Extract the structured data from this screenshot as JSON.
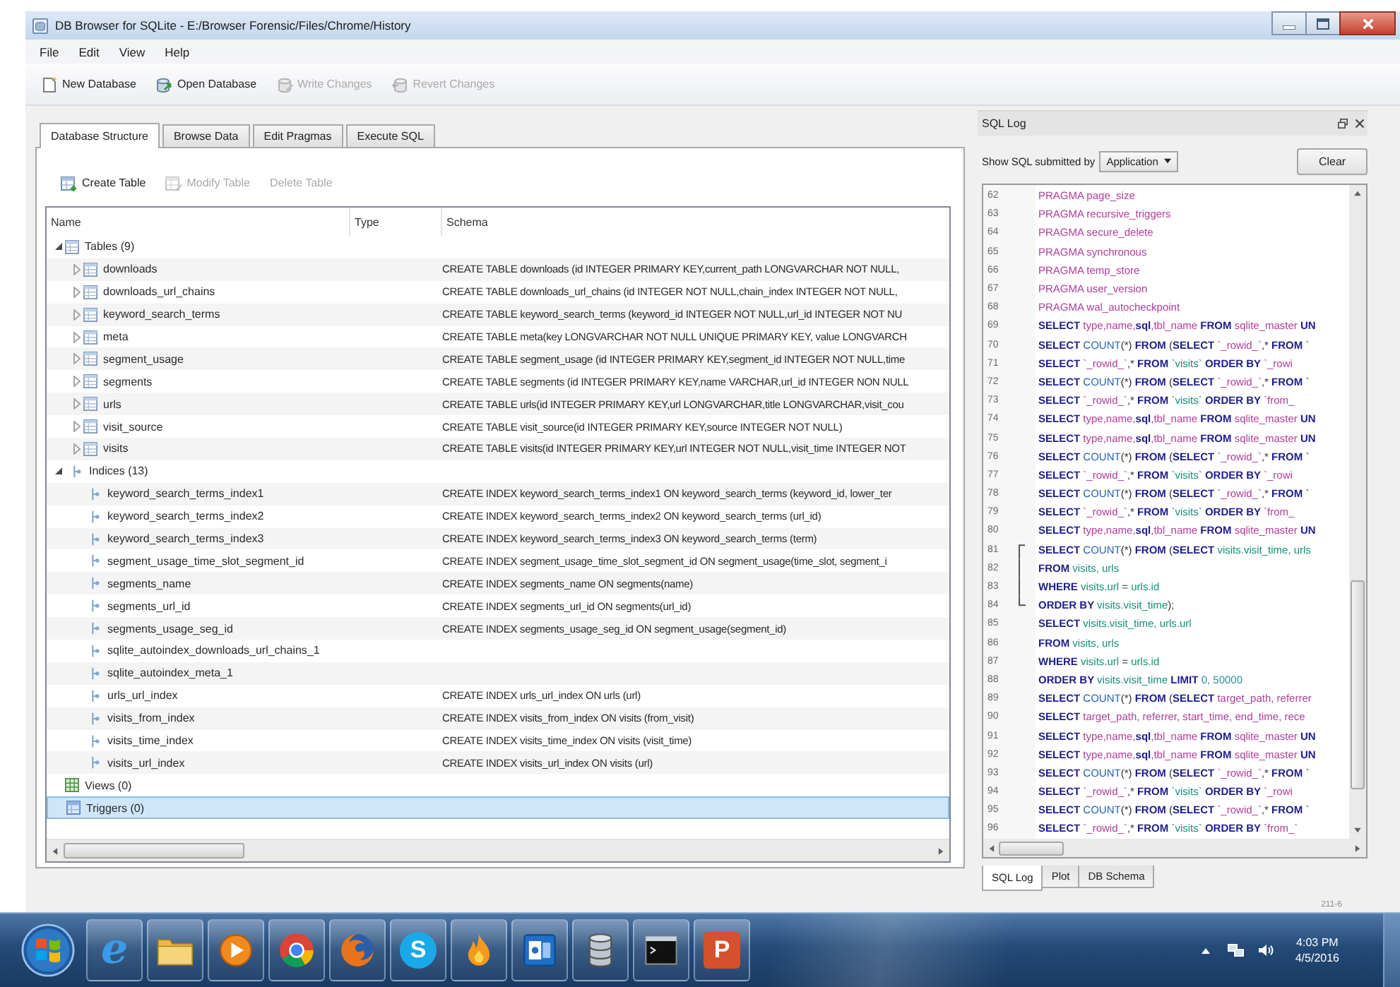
{
  "window": {
    "title": "DB Browser for SQLite - E:/Browser Forensic/Files/Chrome/History"
  },
  "menu": [
    "File",
    "Edit",
    "View",
    "Help"
  ],
  "toolbar": [
    {
      "label": "New Database",
      "kind": "new",
      "disabled": false
    },
    {
      "label": "Open Database",
      "kind": "open",
      "disabled": false
    },
    {
      "label": "Write Changes",
      "kind": "write",
      "disabled": true
    },
    {
      "label": "Revert Changes",
      "kind": "revert",
      "disabled": true
    }
  ],
  "tabs": [
    {
      "label": "Database Structure",
      "selected": true
    },
    {
      "label": "Browse Data",
      "selected": false
    },
    {
      "label": "Edit Pragmas",
      "selected": false
    },
    {
      "label": "Execute SQL",
      "selected": false
    }
  ],
  "actions": [
    {
      "label": "Create Table",
      "kind": "create",
      "disabled": false
    },
    {
      "label": "Modify Table",
      "kind": "modify",
      "disabled": true
    },
    {
      "label": "Delete Table",
      "kind": "delete",
      "disabled": true
    }
  ],
  "tree": {
    "columns": [
      "Name",
      "Type",
      "Schema"
    ],
    "items": [
      {
        "name": "Tables (9)",
        "kind": "table",
        "expanded": true,
        "selected": false,
        "children": [
          {
            "name": "downloads",
            "kind": "table",
            "expanded": false,
            "selected": false,
            "schema": "CREATE TABLE downloads (id INTEGER PRIMARY KEY,current_path LONGVARCHAR NOT NULL,"
          },
          {
            "name": "downloads_url_chains",
            "kind": "table",
            "expanded": false,
            "selected": false,
            "schema": "CREATE TABLE downloads_url_chains (id INTEGER NOT NULL,chain_index INTEGER NOT NULL,"
          },
          {
            "name": "keyword_search_terms",
            "kind": "table",
            "expanded": false,
            "selected": false,
            "schema": "CREATE TABLE keyword_search_terms (keyword_id INTEGER NOT NULL,url_id INTEGER NOT NU"
          },
          {
            "name": "meta",
            "kind": "table",
            "expanded": false,
            "selected": false,
            "schema": "CREATE TABLE meta(key LONGVARCHAR NOT NULL UNIQUE PRIMARY KEY, value LONGVARCH"
          },
          {
            "name": "segment_usage",
            "kind": "table",
            "expanded": false,
            "selected": false,
            "schema": "CREATE TABLE segment_usage (id INTEGER PRIMARY KEY,segment_id INTEGER NOT NULL,time"
          },
          {
            "name": "segments",
            "kind": "table",
            "expanded": false,
            "selected": false,
            "schema": "CREATE TABLE segments (id INTEGER PRIMARY KEY,name VARCHAR,url_id INTEGER NON NULL"
          },
          {
            "name": "urls",
            "kind": "table",
            "expanded": false,
            "selected": false,
            "schema": "CREATE TABLE urls(id INTEGER PRIMARY KEY,url LONGVARCHAR,title LONGVARCHAR,visit_cou"
          },
          {
            "name": "visit_source",
            "kind": "table",
            "expanded": false,
            "selected": false,
            "schema": "CREATE TABLE visit_source(id INTEGER PRIMARY KEY,source INTEGER NOT NULL)"
          },
          {
            "name": "visits",
            "kind": "table",
            "expanded": false,
            "selected": false,
            "schema": "CREATE TABLE visits(id INTEGER PRIMARY KEY,url INTEGER NOT NULL,visit_time INTEGER NOT"
          }
        ]
      },
      {
        "name": "Indices (13)",
        "kind": "index",
        "expanded": true,
        "selected": false,
        "children": [
          {
            "name": "keyword_search_terms_index1",
            "kind": "index",
            "selected": false,
            "schema": "CREATE INDEX keyword_search_terms_index1 ON keyword_search_terms (keyword_id, lower_ter"
          },
          {
            "name": "keyword_search_terms_index2",
            "kind": "index",
            "selected": false,
            "schema": "CREATE INDEX keyword_search_terms_index2 ON keyword_search_terms (url_id)"
          },
          {
            "name": "keyword_search_terms_index3",
            "kind": "index",
            "selected": false,
            "schema": "CREATE INDEX keyword_search_terms_index3 ON keyword_search_terms (term)"
          },
          {
            "name": "segment_usage_time_slot_segment_id",
            "kind": "index",
            "selected": false,
            "schema": "CREATE INDEX segment_usage_time_slot_segment_id ON segment_usage(time_slot, segment_i"
          },
          {
            "name": "segments_name",
            "kind": "index",
            "selected": false,
            "schema": "CREATE INDEX segments_name ON segments(name)"
          },
          {
            "name": "segments_url_id",
            "kind": "index",
            "selected": false,
            "schema": "CREATE INDEX segments_url_id ON segments(url_id)"
          },
          {
            "name": "segments_usage_seg_id",
            "kind": "index",
            "selected": false,
            "schema": "CREATE INDEX segments_usage_seg_id ON segment_usage(segment_id)"
          },
          {
            "name": "sqlite_autoindex_downloads_url_chains_1",
            "kind": "index",
            "selected": false
          },
          {
            "name": "sqlite_autoindex_meta_1",
            "kind": "index",
            "selected": false
          },
          {
            "name": "urls_url_index",
            "kind": "index",
            "selected": false,
            "schema": "CREATE INDEX urls_url_index ON urls (url)"
          },
          {
            "name": "visits_from_index",
            "kind": "index",
            "selected": false,
            "schema": "CREATE INDEX visits_from_index ON visits (from_visit)"
          },
          {
            "name": "visits_time_index",
            "kind": "index",
            "selected": false,
            "schema": "CREATE INDEX visits_time_index ON visits (visit_time)"
          },
          {
            "name": "visits_url_index",
            "kind": "index",
            "selected": false,
            "schema": "CREATE INDEX visits_url_index ON visits (url)"
          }
        ]
      },
      {
        "name": "Views (0)",
        "kind": "view",
        "selected": false
      },
      {
        "name": "Triggers (0)",
        "kind": "trigger",
        "selected": true
      }
    ]
  },
  "sql_log": {
    "title": "SQL Log",
    "filter_label": "Show SQL submitted by",
    "filter_value": "Application",
    "clear_label": "Clear",
    "lines": [
      {
        "number": "62",
        "tokens": [
          {
            "kind": "identifier",
            "text": "PRAGMA page_size"
          }
        ]
      },
      {
        "number": "63",
        "tokens": [
          {
            "kind": "identifier",
            "text": "PRAGMA recursive_triggers"
          }
        ]
      },
      {
        "number": "64",
        "tokens": [
          {
            "kind": "identifier",
            "text": "PRAGMA secure_delete"
          }
        ]
      },
      {
        "number": "65",
        "tokens": [
          {
            "kind": "identifier",
            "text": "PRAGMA synchronous"
          }
        ]
      },
      {
        "number": "66",
        "tokens": [
          {
            "kind": "identifier",
            "text": "PRAGMA temp_store"
          }
        ]
      },
      {
        "number": "67",
        "tokens": [
          {
            "kind": "identifier",
            "text": "PRAGMA user_version"
          }
        ]
      },
      {
        "number": "68",
        "tokens": [
          {
            "kind": "identifier",
            "text": "PRAGMA wal_autocheckpoint"
          }
        ]
      },
      {
        "number": "69",
        "tokens": [
          {
            "kind": "keyword",
            "text": "SELECT "
          },
          {
            "kind": "identifier",
            "text": "type,name,"
          },
          {
            "kind": "keyword",
            "text": "sql"
          },
          {
            "kind": "identifier",
            "text": ",tbl_name "
          },
          {
            "kind": "keyword",
            "text": "FROM "
          },
          {
            "kind": "identifier",
            "text": "sqlite_master "
          },
          {
            "kind": "keyword",
            "text": "UN"
          }
        ]
      },
      {
        "number": "70",
        "tokens": [
          {
            "kind": "keyword",
            "text": "SELECT "
          },
          {
            "kind": "function",
            "text": "COUNT"
          },
          {
            "kind": "punct",
            "text": "(*) "
          },
          {
            "kind": "keyword",
            "text": "FROM "
          },
          {
            "kind": "punct",
            "text": "("
          },
          {
            "kind": "keyword",
            "text": "SELECT "
          },
          {
            "kind": "identifier",
            "text": "`_rowid_`"
          },
          {
            "kind": "punct",
            "text": ",* "
          },
          {
            "kind": "keyword",
            "text": "FROM "
          },
          {
            "kind": "punct",
            "text": "`"
          }
        ]
      },
      {
        "number": "71",
        "tokens": [
          {
            "kind": "keyword",
            "text": "SELECT "
          },
          {
            "kind": "identifier",
            "text": "`_rowid_`"
          },
          {
            "kind": "punct",
            "text": ",* "
          },
          {
            "kind": "keyword",
            "text": "FROM "
          },
          {
            "kind": "object",
            "text": "`visits` "
          },
          {
            "kind": "keyword",
            "text": "ORDER BY "
          },
          {
            "kind": "identifier",
            "text": "`_rowi"
          }
        ]
      },
      {
        "number": "72",
        "tokens": [
          {
            "kind": "keyword",
            "text": "SELECT "
          },
          {
            "kind": "function",
            "text": "COUNT"
          },
          {
            "kind": "punct",
            "text": "(*) "
          },
          {
            "kind": "keyword",
            "text": "FROM "
          },
          {
            "kind": "punct",
            "text": "("
          },
          {
            "kind": "keyword",
            "text": "SELECT "
          },
          {
            "kind": "identifier",
            "text": "`_rowid_`"
          },
          {
            "kind": "punct",
            "text": ",* "
          },
          {
            "kind": "keyword",
            "text": "FROM "
          },
          {
            "kind": "punct",
            "text": "`"
          }
        ]
      },
      {
        "number": "73",
        "tokens": [
          {
            "kind": "keyword",
            "text": "SELECT "
          },
          {
            "kind": "identifier",
            "text": "`_rowid_`"
          },
          {
            "kind": "punct",
            "text": ",* "
          },
          {
            "kind": "keyword",
            "text": "FROM "
          },
          {
            "kind": "object",
            "text": "`visits` "
          },
          {
            "kind": "keyword",
            "text": "ORDER BY "
          },
          {
            "kind": "identifier",
            "text": "`from_"
          }
        ]
      },
      {
        "number": "74",
        "tokens": [
          {
            "kind": "keyword",
            "text": "SELECT "
          },
          {
            "kind": "identifier",
            "text": "type,name,"
          },
          {
            "kind": "keyword",
            "text": "sql"
          },
          {
            "kind": "identifier",
            "text": ",tbl_name "
          },
          {
            "kind": "keyword",
            "text": "FROM "
          },
          {
            "kind": "identifier",
            "text": "sqlite_master "
          },
          {
            "kind": "keyword",
            "text": "UN"
          }
        ]
      },
      {
        "number": "75",
        "tokens": [
          {
            "kind": "keyword",
            "text": "SELECT "
          },
          {
            "kind": "identifier",
            "text": "type,name,"
          },
          {
            "kind": "keyword",
            "text": "sql"
          },
          {
            "kind": "identifier",
            "text": ",tbl_name "
          },
          {
            "kind": "keyword",
            "text": "FROM "
          },
          {
            "kind": "identifier",
            "text": "sqlite_master "
          },
          {
            "kind": "keyword",
            "text": "UN"
          }
        ]
      },
      {
        "number": "76",
        "tokens": [
          {
            "kind": "keyword",
            "text": "SELECT "
          },
          {
            "kind": "function",
            "text": "COUNT"
          },
          {
            "kind": "punct",
            "text": "(*) "
          },
          {
            "kind": "keyword",
            "text": "FROM "
          },
          {
            "kind": "punct",
            "text": "("
          },
          {
            "kind": "keyword",
            "text": "SELECT "
          },
          {
            "kind": "identifier",
            "text": "`_rowid_`"
          },
          {
            "kind": "punct",
            "text": ",* "
          },
          {
            "kind": "keyword",
            "text": "FROM "
          },
          {
            "kind": "punct",
            "text": "`"
          }
        ]
      },
      {
        "number": "77",
        "tokens": [
          {
            "kind": "keyword",
            "text": "SELECT "
          },
          {
            "kind": "identifier",
            "text": "`_rowid_`"
          },
          {
            "kind": "punct",
            "text": ",* "
          },
          {
            "kind": "keyword",
            "text": "FROM "
          },
          {
            "kind": "object",
            "text": "`visits` "
          },
          {
            "kind": "keyword",
            "text": "ORDER BY "
          },
          {
            "kind": "identifier",
            "text": "`_rowi"
          }
        ]
      },
      {
        "number": "78",
        "tokens": [
          {
            "kind": "keyword",
            "text": "SELECT "
          },
          {
            "kind": "function",
            "text": "COUNT"
          },
          {
            "kind": "punct",
            "text": "(*) "
          },
          {
            "kind": "keyword",
            "text": "FROM "
          },
          {
            "kind": "punct",
            "text": "("
          },
          {
            "kind": "keyword",
            "text": "SELECT "
          },
          {
            "kind": "identifier",
            "text": "`_rowid_`"
          },
          {
            "kind": "punct",
            "text": ",* "
          },
          {
            "kind": "keyword",
            "text": "FROM "
          },
          {
            "kind": "punct",
            "text": "`"
          }
        ]
      },
      {
        "number": "79",
        "tokens": [
          {
            "kind": "keyword",
            "text": "SELECT "
          },
          {
            "kind": "identifier",
            "text": "`_rowid_`"
          },
          {
            "kind": "punct",
            "text": ",* "
          },
          {
            "kind": "keyword",
            "text": "FROM "
          },
          {
            "kind": "object",
            "text": "`visits` "
          },
          {
            "kind": "keyword",
            "text": "ORDER BY "
          },
          {
            "kind": "identifier",
            "text": "`from_"
          }
        ]
      },
      {
        "number": "80",
        "tokens": [
          {
            "kind": "keyword",
            "text": "SELECT "
          },
          {
            "kind": "identifier",
            "text": "type,name,"
          },
          {
            "kind": "keyword",
            "text": "sql"
          },
          {
            "kind": "identifier",
            "text": ",tbl_name "
          },
          {
            "kind": "keyword",
            "text": "FROM "
          },
          {
            "kind": "identifier",
            "text": "sqlite_master "
          },
          {
            "kind": "keyword",
            "text": "UN"
          }
        ]
      },
      {
        "number": "81",
        "kind": "fold_start",
        "tokens": [
          {
            "kind": "keyword",
            "text": "SELECT "
          },
          {
            "kind": "function",
            "text": "COUNT"
          },
          {
            "kind": "punct",
            "text": "(*) "
          },
          {
            "kind": "keyword",
            "text": "FROM "
          },
          {
            "kind": "punct",
            "text": "("
          },
          {
            "kind": "keyword",
            "text": "SELECT "
          },
          {
            "kind": "object",
            "text": "visits.visit_time, urls"
          }
        ]
      },
      {
        "number": "82",
        "kind": "fold_middle",
        "tokens": [
          {
            "kind": "keyword",
            "text": "FROM "
          },
          {
            "kind": "object",
            "text": "visits, urls"
          }
        ]
      },
      {
        "number": "83",
        "kind": "fold_middle",
        "tokens": [
          {
            "kind": "keyword",
            "text": "WHERE "
          },
          {
            "kind": "object",
            "text": "visits.url "
          },
          {
            "kind": "punct",
            "text": "= "
          },
          {
            "kind": "object",
            "text": "urls.id"
          }
        ]
      },
      {
        "number": "84",
        "kind": "fold_end",
        "tokens": [
          {
            "kind": "keyword",
            "text": "ORDER BY "
          },
          {
            "kind": "object",
            "text": "visits.visit_time"
          },
          {
            "kind": "punct",
            "text": ");"
          }
        ]
      },
      {
        "number": "85",
        "tokens": [
          {
            "kind": "keyword",
            "text": "SELECT "
          },
          {
            "kind": "object",
            "text": "visits.visit_time, urls.url"
          }
        ]
      },
      {
        "number": "86",
        "tokens": [
          {
            "kind": "keyword",
            "text": "FROM "
          },
          {
            "kind": "object",
            "text": "visits, urls"
          }
        ]
      },
      {
        "number": "87",
        "tokens": [
          {
            "kind": "keyword",
            "text": "WHERE "
          },
          {
            "kind": "object",
            "text": "visits.url "
          },
          {
            "kind": "punct",
            "text": "= "
          },
          {
            "kind": "object",
            "text": "urls.id"
          }
        ]
      },
      {
        "number": "88",
        "tokens": [
          {
            "kind": "keyword",
            "text": "ORDER BY "
          },
          {
            "kind": "object",
            "text": "visits.visit_time "
          },
          {
            "kind": "keyword",
            "text": "LIMIT "
          },
          {
            "kind": "number",
            "text": "0, 50000"
          }
        ]
      },
      {
        "number": "89",
        "tokens": [
          {
            "kind": "keyword",
            "text": "SELECT "
          },
          {
            "kind": "function",
            "text": "COUNT"
          },
          {
            "kind": "punct",
            "text": "(*) "
          },
          {
            "kind": "keyword",
            "text": "FROM "
          },
          {
            "kind": "punct",
            "text": "("
          },
          {
            "kind": "keyword",
            "text": "SELECT "
          },
          {
            "kind": "identifier",
            "text": "target_path, referrer"
          }
        ]
      },
      {
        "number": "90",
        "tokens": [
          {
            "kind": "keyword",
            "text": "SELECT "
          },
          {
            "kind": "identifier",
            "text": "target_path, referrer, start_time, end_time, rece"
          }
        ]
      },
      {
        "number": "91",
        "tokens": [
          {
            "kind": "keyword",
            "text": "SELECT "
          },
          {
            "kind": "identifier",
            "text": "type,name,"
          },
          {
            "kind": "keyword",
            "text": "sql"
          },
          {
            "kind": "identifier",
            "text": ",tbl_name "
          },
          {
            "kind": "keyword",
            "text": "FROM "
          },
          {
            "kind": "identifier",
            "text": "sqlite_master "
          },
          {
            "kind": "keyword",
            "text": "UN"
          }
        ]
      },
      {
        "number": "92",
        "tokens": [
          {
            "kind": "keyword",
            "text": "SELECT "
          },
          {
            "kind": "identifier",
            "text": "type,name,"
          },
          {
            "kind": "keyword",
            "text": "sql"
          },
          {
            "kind": "identifier",
            "text": ",tbl_name "
          },
          {
            "kind": "keyword",
            "text": "FROM "
          },
          {
            "kind": "identifier",
            "text": "sqlite_master "
          },
          {
            "kind": "keyword",
            "text": "UN"
          }
        ]
      },
      {
        "number": "93",
        "tokens": [
          {
            "kind": "keyword",
            "text": "SELECT "
          },
          {
            "kind": "function",
            "text": "COUNT"
          },
          {
            "kind": "punct",
            "text": "(*) "
          },
          {
            "kind": "keyword",
            "text": "FROM "
          },
          {
            "kind": "punct",
            "text": "("
          },
          {
            "kind": "keyword",
            "text": "SELECT "
          },
          {
            "kind": "identifier",
            "text": "`_rowid_`"
          },
          {
            "kind": "punct",
            "text": ",* "
          },
          {
            "kind": "keyword",
            "text": "FROM "
          },
          {
            "kind": "punct",
            "text": "`"
          }
        ]
      },
      {
        "number": "94",
        "tokens": [
          {
            "kind": "keyword",
            "text": "SELECT "
          },
          {
            "kind": "identifier",
            "text": "`_rowid_`"
          },
          {
            "kind": "punct",
            "text": ",* "
          },
          {
            "kind": "keyword",
            "text": "FROM "
          },
          {
            "kind": "object",
            "text": "`visits` "
          },
          {
            "kind": "keyword",
            "text": "ORDER BY "
          },
          {
            "kind": "identifier",
            "text": "`_rowi"
          }
        ]
      },
      {
        "number": "95",
        "tokens": [
          {
            "kind": "keyword",
            "text": "SELECT "
          },
          {
            "kind": "function",
            "text": "COUNT"
          },
          {
            "kind": "punct",
            "text": "(*) "
          },
          {
            "kind": "keyword",
            "text": "FROM "
          },
          {
            "kind": "punct",
            "text": "("
          },
          {
            "kind": "keyword",
            "text": "SELECT "
          },
          {
            "kind": "identifier",
            "text": "`_rowid_`"
          },
          {
            "kind": "punct",
            "text": ",* "
          },
          {
            "kind": "keyword",
            "text": "FROM "
          },
          {
            "kind": "punct",
            "text": "`"
          }
        ]
      },
      {
        "number": "96",
        "tokens": [
          {
            "kind": "keyword",
            "text": "SELECT "
          },
          {
            "kind": "identifier",
            "text": "`_rowid_`"
          },
          {
            "kind": "punct",
            "text": ",* "
          },
          {
            "kind": "keyword",
            "text": "FROM "
          },
          {
            "kind": "object",
            "text": "`visits` "
          },
          {
            "kind": "keyword",
            "text": "ORDER BY "
          },
          {
            "kind": "identifier",
            "text": "`from_`"
          }
        ]
      }
    ],
    "tabs": [
      {
        "label": "SQL Log",
        "selected": true
      },
      {
        "label": "Plot",
        "selected": false
      },
      {
        "label": "DB Schema",
        "selected": false
      }
    ]
  },
  "corner_note": "211-6",
  "taskbar": {
    "apps": [
      {
        "kind": "browser",
        "glyph": "e"
      },
      {
        "kind": "folder"
      },
      {
        "kind": "media"
      },
      {
        "kind": "wheel"
      },
      {
        "kind": "globe"
      },
      {
        "kind": "chat",
        "glyph": "S"
      },
      {
        "kind": "flame"
      },
      {
        "kind": "mail"
      },
      {
        "kind": "database"
      },
      {
        "kind": "terminal"
      },
      {
        "kind": "slides",
        "glyph": "P"
      }
    ],
    "clock": {
      "time": "4:03 PM",
      "date": "4/5/2016"
    }
  }
}
